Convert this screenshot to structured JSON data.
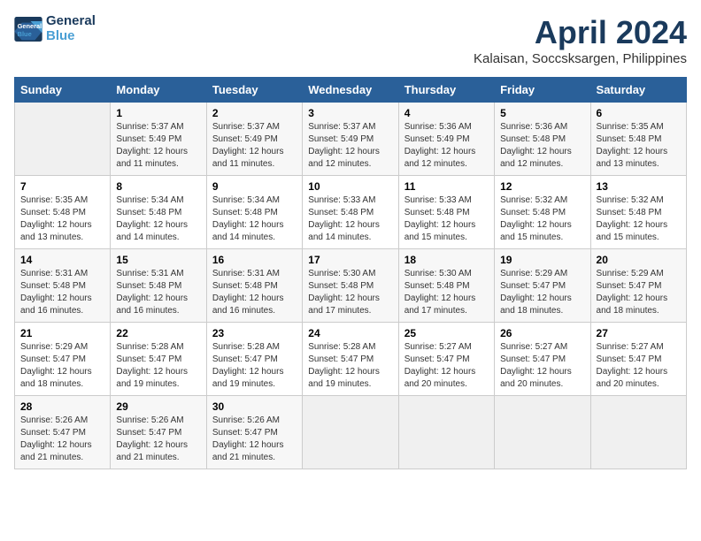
{
  "header": {
    "logo_line1": "General",
    "logo_line2": "Blue",
    "month": "April 2024",
    "location": "Kalaisan, Soccsksargen, Philippines"
  },
  "columns": [
    "Sunday",
    "Monday",
    "Tuesday",
    "Wednesday",
    "Thursday",
    "Friday",
    "Saturday"
  ],
  "weeks": [
    [
      {
        "day": "",
        "info": ""
      },
      {
        "day": "1",
        "info": "Sunrise: 5:37 AM\nSunset: 5:49 PM\nDaylight: 12 hours\nand 11 minutes."
      },
      {
        "day": "2",
        "info": "Sunrise: 5:37 AM\nSunset: 5:49 PM\nDaylight: 12 hours\nand 11 minutes."
      },
      {
        "day": "3",
        "info": "Sunrise: 5:37 AM\nSunset: 5:49 PM\nDaylight: 12 hours\nand 12 minutes."
      },
      {
        "day": "4",
        "info": "Sunrise: 5:36 AM\nSunset: 5:49 PM\nDaylight: 12 hours\nand 12 minutes."
      },
      {
        "day": "5",
        "info": "Sunrise: 5:36 AM\nSunset: 5:48 PM\nDaylight: 12 hours\nand 12 minutes."
      },
      {
        "day": "6",
        "info": "Sunrise: 5:35 AM\nSunset: 5:48 PM\nDaylight: 12 hours\nand 13 minutes."
      }
    ],
    [
      {
        "day": "7",
        "info": "Sunrise: 5:35 AM\nSunset: 5:48 PM\nDaylight: 12 hours\nand 13 minutes."
      },
      {
        "day": "8",
        "info": "Sunrise: 5:34 AM\nSunset: 5:48 PM\nDaylight: 12 hours\nand 14 minutes."
      },
      {
        "day": "9",
        "info": "Sunrise: 5:34 AM\nSunset: 5:48 PM\nDaylight: 12 hours\nand 14 minutes."
      },
      {
        "day": "10",
        "info": "Sunrise: 5:33 AM\nSunset: 5:48 PM\nDaylight: 12 hours\nand 14 minutes."
      },
      {
        "day": "11",
        "info": "Sunrise: 5:33 AM\nSunset: 5:48 PM\nDaylight: 12 hours\nand 15 minutes."
      },
      {
        "day": "12",
        "info": "Sunrise: 5:32 AM\nSunset: 5:48 PM\nDaylight: 12 hours\nand 15 minutes."
      },
      {
        "day": "13",
        "info": "Sunrise: 5:32 AM\nSunset: 5:48 PM\nDaylight: 12 hours\nand 15 minutes."
      }
    ],
    [
      {
        "day": "14",
        "info": "Sunrise: 5:31 AM\nSunset: 5:48 PM\nDaylight: 12 hours\nand 16 minutes."
      },
      {
        "day": "15",
        "info": "Sunrise: 5:31 AM\nSunset: 5:48 PM\nDaylight: 12 hours\nand 16 minutes."
      },
      {
        "day": "16",
        "info": "Sunrise: 5:31 AM\nSunset: 5:48 PM\nDaylight: 12 hours\nand 16 minutes."
      },
      {
        "day": "17",
        "info": "Sunrise: 5:30 AM\nSunset: 5:48 PM\nDaylight: 12 hours\nand 17 minutes."
      },
      {
        "day": "18",
        "info": "Sunrise: 5:30 AM\nSunset: 5:48 PM\nDaylight: 12 hours\nand 17 minutes."
      },
      {
        "day": "19",
        "info": "Sunrise: 5:29 AM\nSunset: 5:47 PM\nDaylight: 12 hours\nand 18 minutes."
      },
      {
        "day": "20",
        "info": "Sunrise: 5:29 AM\nSunset: 5:47 PM\nDaylight: 12 hours\nand 18 minutes."
      }
    ],
    [
      {
        "day": "21",
        "info": "Sunrise: 5:29 AM\nSunset: 5:47 PM\nDaylight: 12 hours\nand 18 minutes."
      },
      {
        "day": "22",
        "info": "Sunrise: 5:28 AM\nSunset: 5:47 PM\nDaylight: 12 hours\nand 19 minutes."
      },
      {
        "day": "23",
        "info": "Sunrise: 5:28 AM\nSunset: 5:47 PM\nDaylight: 12 hours\nand 19 minutes."
      },
      {
        "day": "24",
        "info": "Sunrise: 5:28 AM\nSunset: 5:47 PM\nDaylight: 12 hours\nand 19 minutes."
      },
      {
        "day": "25",
        "info": "Sunrise: 5:27 AM\nSunset: 5:47 PM\nDaylight: 12 hours\nand 20 minutes."
      },
      {
        "day": "26",
        "info": "Sunrise: 5:27 AM\nSunset: 5:47 PM\nDaylight: 12 hours\nand 20 minutes."
      },
      {
        "day": "27",
        "info": "Sunrise: 5:27 AM\nSunset: 5:47 PM\nDaylight: 12 hours\nand 20 minutes."
      }
    ],
    [
      {
        "day": "28",
        "info": "Sunrise: 5:26 AM\nSunset: 5:47 PM\nDaylight: 12 hours\nand 21 minutes."
      },
      {
        "day": "29",
        "info": "Sunrise: 5:26 AM\nSunset: 5:47 PM\nDaylight: 12 hours\nand 21 minutes."
      },
      {
        "day": "30",
        "info": "Sunrise: 5:26 AM\nSunset: 5:47 PM\nDaylight: 12 hours\nand 21 minutes."
      },
      {
        "day": "",
        "info": ""
      },
      {
        "day": "",
        "info": ""
      },
      {
        "day": "",
        "info": ""
      },
      {
        "day": "",
        "info": ""
      }
    ]
  ]
}
